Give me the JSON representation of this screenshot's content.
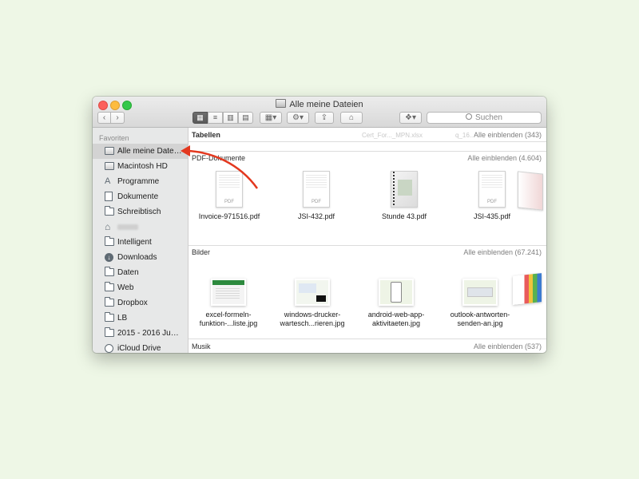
{
  "window": {
    "title": "Alle meine Dateien"
  },
  "toolbar": {
    "back": "‹",
    "forward": "›",
    "search_placeholder": "Suchen",
    "view_icons": [
      "icon-view-icon",
      "list-view-icon",
      "column-view-icon",
      "coverflow-view-icon"
    ]
  },
  "sidebar": {
    "header": "Favoriten",
    "items": [
      {
        "label": "Alle meine Date…",
        "icon": "all-files-icon"
      },
      {
        "label": "Macintosh HD",
        "icon": "drive-icon"
      },
      {
        "label": "Programme",
        "icon": "applications-icon"
      },
      {
        "label": "Dokumente",
        "icon": "documents-icon"
      },
      {
        "label": "Schreibtisch",
        "icon": "folder-icon"
      },
      {
        "label": "",
        "icon": "home-icon"
      },
      {
        "label": "Intelligent",
        "icon": "folder-icon"
      },
      {
        "label": "Downloads",
        "icon": "downloads-icon"
      },
      {
        "label": "Daten",
        "icon": "folder-icon"
      },
      {
        "label": "Web",
        "icon": "folder-icon"
      },
      {
        "label": "Dropbox",
        "icon": "folder-icon"
      },
      {
        "label": "LB",
        "icon": "folder-icon"
      },
      {
        "label": "2015 - 2016 Ju…",
        "icon": "folder-icon"
      },
      {
        "label": "iCloud Drive",
        "icon": "icloud-icon"
      }
    ]
  },
  "sections": {
    "tabellen": {
      "title": "Tabellen",
      "show_all": "Alle einblenden (343)",
      "faded": [
        "Cert_For..._MPN.xlsx",
        "q_16..."
      ]
    },
    "pdf": {
      "title": "PDF-Dokumente",
      "show_all": "Alle einblenden (4.604)",
      "files": [
        "Invoice-971516.pdf",
        "JSI-432.pdf",
        "Stunde 43.pdf",
        "JSI-435.pdf"
      ],
      "thumb_label": "PDF"
    },
    "bilder": {
      "title": "Bilder",
      "show_all": "Alle einblenden (67.241)",
      "files": [
        {
          "line1": "excel-formeln-",
          "line2": "funktion-...liste.jpg"
        },
        {
          "line1": "windows-drucker-",
          "line2": "wartesch...rieren.jpg"
        },
        {
          "line1": "android-web-app-",
          "line2": "aktivitaeten.jpg"
        },
        {
          "line1": "outlook-antworten-",
          "line2": "senden-an.jpg"
        }
      ]
    },
    "musik": {
      "title": "Musik",
      "show_all": "Alle einblenden (537)"
    }
  },
  "colors": {
    "arrow": "#e3381f",
    "selection": "#d3d3d3",
    "sidebar_bg": "#e7e8e8",
    "background": "#eef7e6"
  }
}
